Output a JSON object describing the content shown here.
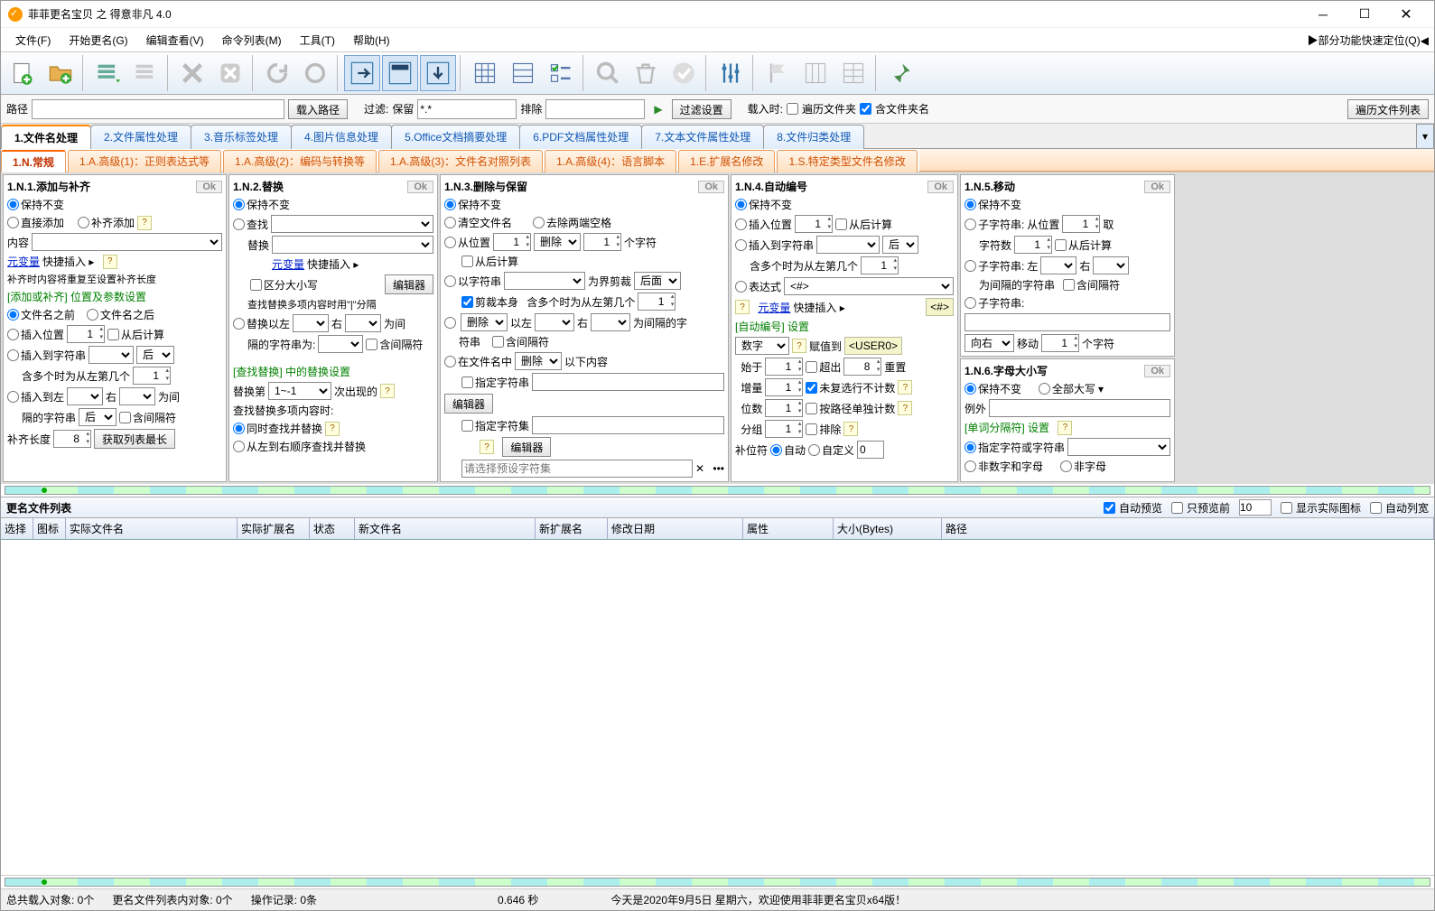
{
  "title": "菲菲更名宝贝 之 得意非凡 4.0",
  "menu": [
    "文件(F)",
    "开始更名(G)",
    "编辑查看(V)",
    "命令列表(M)",
    "工具(T)",
    "帮助(H)"
  ],
  "quicknav": "▶部分功能快速定位(Q)◀",
  "pathrow": {
    "path_label": "路径",
    "load_path_btn": "载入路径",
    "filter_label": "过滤:",
    "keep_label": "保留",
    "keep_value": "*.*",
    "exclude_label": "排除",
    "filter_settings": "过滤设置",
    "onload_label": "载入时:",
    "recurse": "遍历文件夹",
    "include_dirname": "含文件夹名",
    "traverse_btn": "遍历文件列表"
  },
  "main_tabs": [
    "1.文件名处理",
    "2.文件属性处理",
    "3.音乐标签处理",
    "4.图片信息处理",
    "5.Office文档摘要处理",
    "6.PDF文档属性处理",
    "7.文本文件属性处理",
    "8.文件归类处理"
  ],
  "sub_tabs": [
    "1.N.常规",
    "1.A.高级(1)：正则表达式等",
    "1.A.高级(2)：编码与转换等",
    "1.A.高级(3)：文件名对照列表",
    "1.A.高级(4)：语言脚本",
    "1.E.扩展名修改",
    "1.S.特定类型文件名修改"
  ],
  "ok": "Ok",
  "keep": "保持不变",
  "p1": {
    "title": "1.N.1.添加与补齐",
    "direct_add": "直接添加",
    "pad_add": "补齐添加",
    "content": "内容",
    "meta_link": "元变量",
    "quick_insert": "快捷插入 ▸",
    "pad_note": "补齐时内容将重复至设置补齐长度",
    "sec1": "[添加或补齐] 位置及参数设置",
    "before": "文件名之前",
    "after": "文件名之后",
    "ins_pos": "插入位置",
    "from_back": "从后计算",
    "ins_to_str": "插入到字符串",
    "rear": "后",
    "multi_firstn": "含多个时为从左第几个",
    "ins_to_left": "插入到左",
    "right": "右",
    "between": "为间",
    "sep_str": "隔的字符串",
    "inc_sep": "含间隔符",
    "pad_len": "补齐长度",
    "get_max": "获取列表最长"
  },
  "p2": {
    "title": "1.N.2.替换",
    "find": "查找",
    "replace": "替换",
    "meta_link": "元变量",
    "quick_insert": "快捷插入 ▸",
    "case": "区分大小写",
    "editor": "编辑器",
    "multi_note": "查找替换多项内容时用\"|\"分隔",
    "replace_left": "替换以左",
    "right": "右",
    "between": "为间",
    "sep_str": "隔的字符串为:",
    "inc_sep": "含间隔符",
    "sec2": "[查找替换] 中的替换设置",
    "replace_nth": "替换第",
    "nth_val": "1~-1",
    "occurrence": "次出现的",
    "multi_when": "查找替换多项内容时:",
    "simul": "同时查找并替换",
    "seq": "从左到右顺序查找并替换"
  },
  "p3": {
    "title": "1.N.3.删除与保留",
    "clear": "清空文件名",
    "trim": "去除两端空格",
    "from_pos": "从位置",
    "delete": "删除",
    "chars": "个字符",
    "from_back": "从后计算",
    "by_str": "以字符串",
    "trim_boundary": "为界剪裁",
    "rear": "后面",
    "cut_self": "剪裁本身",
    "multi_firstn": "含多个时为从左第几个",
    "del2": "删除",
    "by_left": "以左",
    "right": "右",
    "between_str": "为间隔的字",
    "sep": "符串",
    "inc_sep": "含间隔符",
    "in_filename": "在文件名中",
    "below": "以下内容",
    "spec_str": "指定字符串",
    "spec_set": "指定字符集",
    "editor": "编辑器",
    "choose_preset": "请选择预设字符集"
  },
  "p4": {
    "title": "1.N.4.自动编号",
    "ins_pos": "插入位置",
    "from_back": "从后计算",
    "ins_to_str": "插入到字符串",
    "rear": "后",
    "multi_firstn": "含多个时为从左第几个",
    "expr": "表达式",
    "expr_val": "<#>",
    "meta_link": "元变量",
    "quick_insert": "快捷插入 ▸",
    "sec": "[自动编号] 设置",
    "number": "数字",
    "assign_to": "赋值到",
    "user0": "<USER0>",
    "start": "始于",
    "overflow": "超出",
    "reset": "重置",
    "incr": "增量",
    "no_repeat": "未复选行不计数",
    "digits": "位数",
    "by_path": "按路径单独计数",
    "group": "分组",
    "exclude": "排除",
    "pad_char": "补位符",
    "auto": "自动",
    "custom": "自定义"
  },
  "p5": {
    "title": "1.N.5.移动",
    "substr": "子字符串:",
    "from_pos": "从位置",
    "take": "取",
    "char_count": "字符数",
    "from_back": "从后计算",
    "substr2": "子字符串:",
    "left": "左",
    "right": "右",
    "between_sep": "为间隔的字符串",
    "inc_sep": "含间隔符",
    "substr3": "子字符串:",
    "to_right": "向右",
    "move": "移动",
    "chars": "个字符"
  },
  "p6": {
    "title": "1.N.6.字母大小写",
    "all_upper": "全部大写",
    "example": "例外",
    "sec": "[单词分隔符] 设置",
    "spec_char": "指定字符或字符串",
    "non_alnum": "非数字和字母",
    "non_alpha": "非字母"
  },
  "list": {
    "heading": "更名文件列表",
    "auto_preview": "自动预览",
    "only_first": "只预览前",
    "only_first_n": "10",
    "show_icon": "显示实际图标",
    "auto_colw": "自动列宽",
    "cols": [
      "选择",
      "图标",
      "实际文件名",
      "实际扩展名",
      "状态",
      "新文件名",
      "新扩展名",
      "修改日期",
      "属性",
      "大小(Bytes)",
      "路径"
    ]
  },
  "status": {
    "loaded": "总共载入对象: 0个",
    "inlist": "更名文件列表内对象: 0个",
    "oplog": "操作记录: 0条",
    "time": "0.646 秒",
    "msg": "今天是2020年9月5日 星期六，欢迎使用菲菲更名宝贝x64版！"
  }
}
